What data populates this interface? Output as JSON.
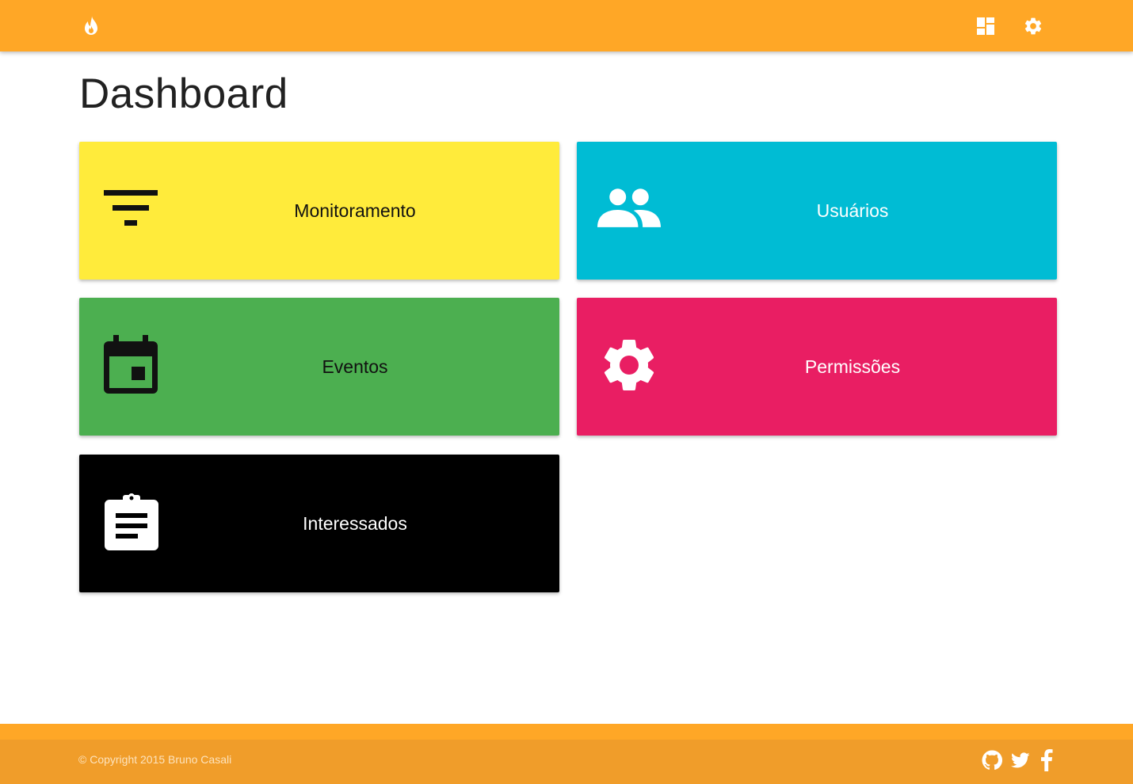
{
  "header": {
    "brand_icon": "fire-icon",
    "nav": [
      {
        "icon": "dashboard-icon"
      },
      {
        "icon": "gear-icon"
      }
    ],
    "color": "#ffa726"
  },
  "main": {
    "title": "Dashboard",
    "tiles": [
      {
        "label": "Monitoramento",
        "icon": "filter-icon",
        "color": "#ffeb3b"
      },
      {
        "label": "Usuários",
        "icon": "people-icon",
        "color": "#00bcd4"
      },
      {
        "label": "Eventos",
        "icon": "calendar-icon",
        "color": "#4caf50"
      },
      {
        "label": "Permissões",
        "icon": "gear-icon",
        "color": "#e91e63"
      },
      {
        "label": "Interessados",
        "icon": "clipboard-icon",
        "color": "#000000"
      }
    ]
  },
  "footer": {
    "copyright": "© Copyright 2015 Bruno Casali",
    "social": [
      {
        "icon": "github-icon"
      },
      {
        "icon": "twitter-icon"
      },
      {
        "icon": "facebook-icon"
      }
    ],
    "color": "#f09d2a"
  }
}
